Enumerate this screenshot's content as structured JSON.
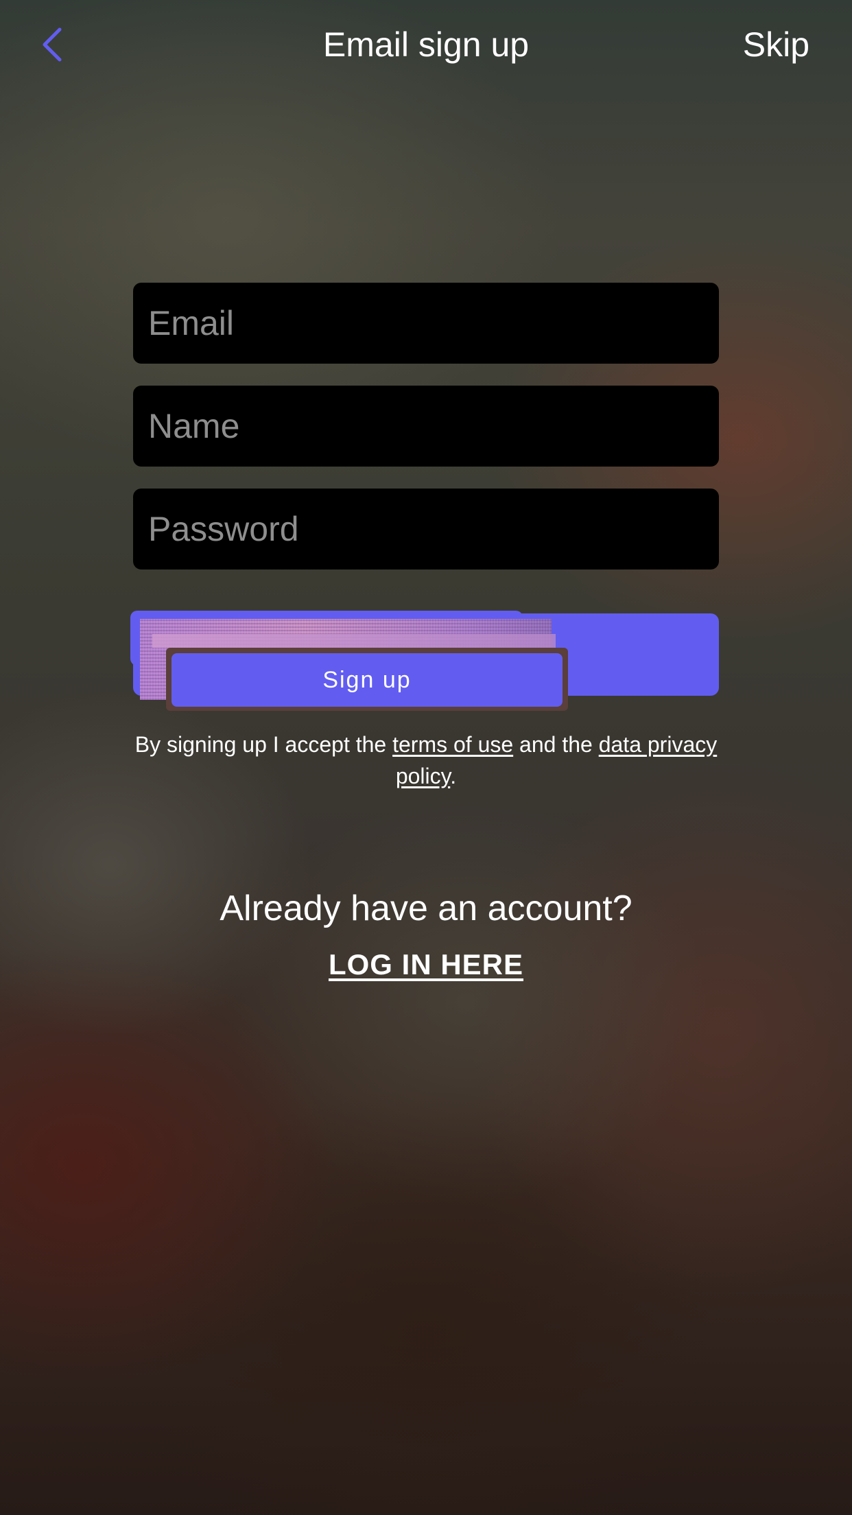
{
  "header": {
    "back_icon": "chevron-left-icon",
    "title": "Email sign up",
    "skip_label": "Skip"
  },
  "form": {
    "email_placeholder": "Email",
    "email_value": "",
    "name_placeholder": "Name",
    "name_value": "",
    "password_placeholder": "Password",
    "password_value": "",
    "signup_label": "Sign up"
  },
  "terms": {
    "prefix": "By signing up I accept the ",
    "terms_link": "terms of use",
    "middle": " and the ",
    "privacy_link": "data privacy policy",
    "suffix": "."
  },
  "login": {
    "prompt": "Already have an account?",
    "link_label": "LOG IN HERE"
  },
  "colors": {
    "accent": "#625df0",
    "field_bg": "#000000",
    "placeholder": "#8e8e8e"
  }
}
